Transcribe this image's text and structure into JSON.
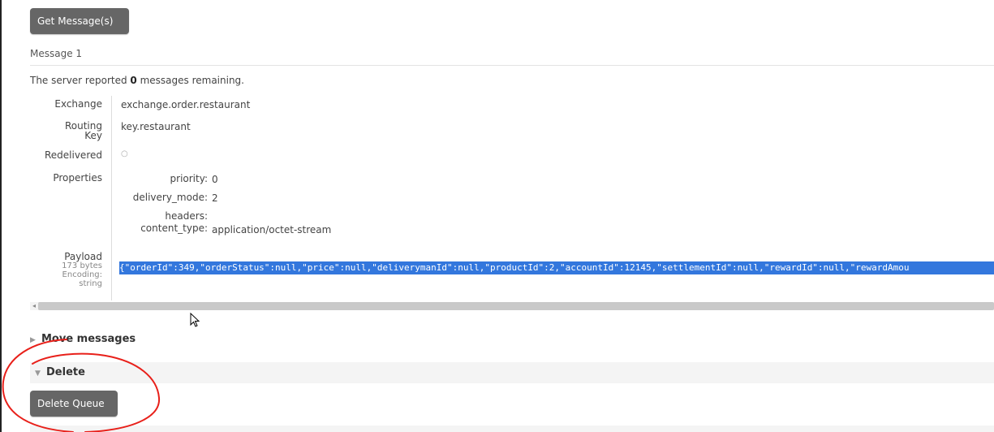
{
  "buttons": {
    "get_messages": "Get Message(s)",
    "delete_queue": "Delete Queue"
  },
  "message": {
    "label": "Message 1",
    "server_prefix": "The server reported ",
    "remaining_count": "0",
    "server_suffix": " messages remaining.",
    "exchange_label": "Exchange",
    "exchange": "exchange.order.restaurant",
    "routing_label_line1": "Routing",
    "routing_label_line2": "Key",
    "routing_key": "key.restaurant",
    "redelivered_label": "Redelivered",
    "redelivered_value": "○",
    "properties_label": "Properties",
    "properties": [
      {
        "key": "priority:",
        "value": "0"
      },
      {
        "key": "delivery_mode:",
        "value": "2"
      },
      {
        "key": "headers:",
        "value": ""
      },
      {
        "key": "content_type:",
        "value": "application/octet-stream"
      }
    ],
    "payload_label": "Payload",
    "payload_size": "173 bytes",
    "payload_encoding_label": "Encoding:",
    "payload_encoding": "string",
    "payload": "{\"orderId\":349,\"orderStatus\":null,\"price\":null,\"deliverymanId\":null,\"productId\":2,\"accountId\":12145,\"settlementId\":null,\"rewardId\":null,\"rewardAmou"
  },
  "sections": {
    "move_messages": "Move messages",
    "delete": "Delete"
  },
  "colors": {
    "button_bg": "#666666",
    "payload_highlight": "#3377dd",
    "annotation": "#e8201a"
  }
}
